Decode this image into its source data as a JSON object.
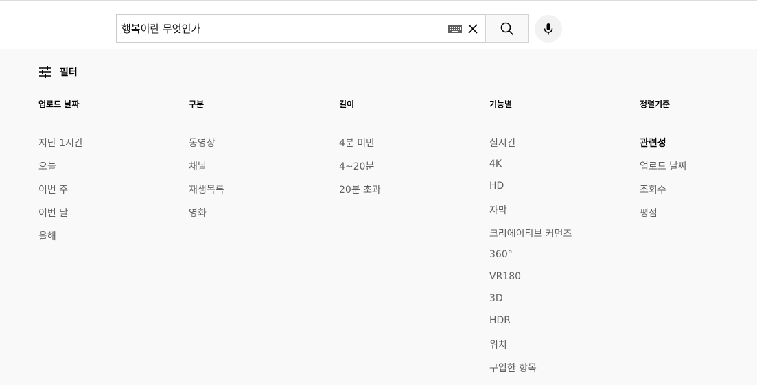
{
  "search": {
    "query": "행복이란 무엇인가",
    "keyboard_icon": "keyboard-icon",
    "clear_icon": "close-icon",
    "search_icon": "search-icon",
    "mic_icon": "microphone-icon"
  },
  "filter_panel": {
    "toggle_label": "필터",
    "toggle_icon": "tune-sliders-icon",
    "groups": [
      {
        "title": "업로드 날짜",
        "options": [
          "지난 1시간",
          "오늘",
          "이번 주",
          "이번 달",
          "올해"
        ]
      },
      {
        "title": "구분",
        "options": [
          "동영상",
          "채널",
          "재생목록",
          "영화"
        ]
      },
      {
        "title": "길이",
        "options": [
          "4분 미만",
          "4~20분",
          "20분 초과"
        ]
      },
      {
        "title": "기능별",
        "options": [
          "실시간",
          "4K",
          "HD",
          "자막",
          "크리에이티브 커먼즈",
          "360°",
          "VR180",
          "3D",
          "HDR",
          "위치",
          "구입한 항목"
        ]
      },
      {
        "title": "정렬기준",
        "options": [
          "관련성",
          "업로드 날짜",
          "조회수",
          "평점"
        ],
        "selected": "관련성"
      }
    ]
  },
  "colors": {
    "panel_background": "#f9f9f9",
    "option_text": "#606060",
    "selected_text": "#030303",
    "divider": "#d9d9d9"
  }
}
